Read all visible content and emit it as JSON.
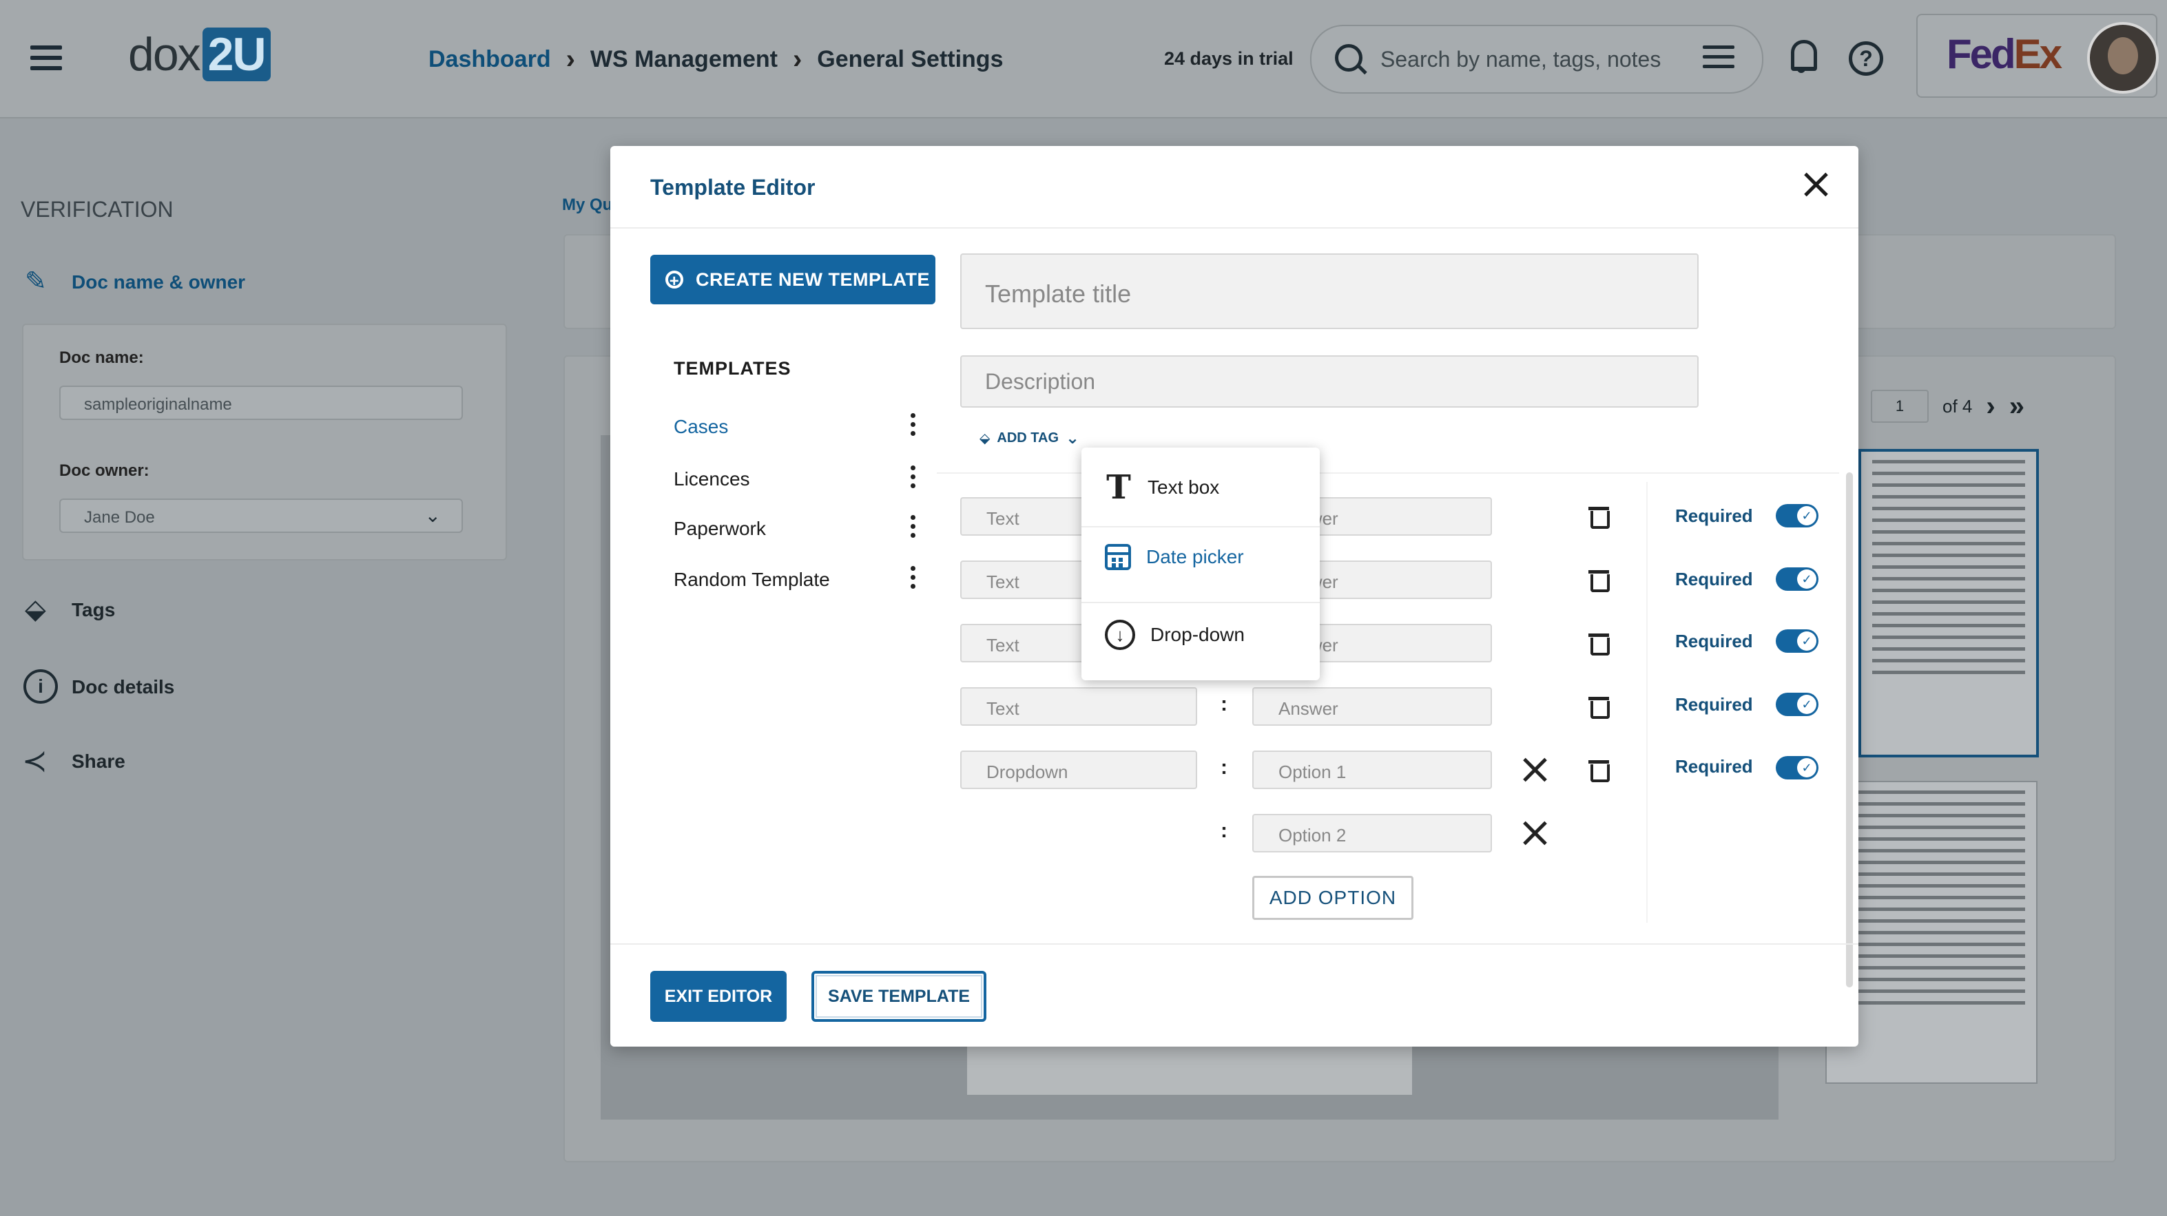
{
  "header": {
    "logo_text": "dox",
    "logo_suffix": "2U",
    "breadcrumb": [
      "Dashboard",
      "WS Management",
      "General Settings"
    ],
    "trial_text": "24 days in trial",
    "search_placeholder": "Search by name, tags, notes",
    "brand_fe": "Fed",
    "brand_ex": "Ex"
  },
  "sidebar": {
    "section_title": "VERIFICATION",
    "items": [
      {
        "label": "Doc name & owner",
        "icon": "pencil-icon"
      },
      {
        "label": "Tags",
        "icon": "tag-icon"
      },
      {
        "label": "Doc details",
        "icon": "info-icon"
      },
      {
        "label": "Share",
        "icon": "share-icon"
      }
    ],
    "doc_name_label": "Doc name:",
    "doc_name_value": "sampleoriginalname",
    "doc_owner_label": "Doc owner:",
    "doc_owner_value": "Jane Doe"
  },
  "background": {
    "my_queue_label": "My Qu",
    "page_current": "1",
    "page_total": "of 4"
  },
  "modal": {
    "title": "Template Editor",
    "create_button": "CREATE NEW TEMPLATE",
    "templates_heading": "TEMPLATES",
    "templates": [
      "Cases",
      "Licences",
      "Paperwork",
      "Random Template"
    ],
    "title_placeholder": "Template title",
    "description_placeholder": "Description",
    "add_tag_label": "ADD TAG",
    "rows": [
      {
        "type": "Text",
        "value": "Answer",
        "required": "Required"
      },
      {
        "type": "Text",
        "value": "Answer",
        "required": "Required"
      },
      {
        "type": "Text",
        "value": "Answer",
        "required": "Required"
      },
      {
        "type": "Text",
        "value": "Answer",
        "required": "Required"
      },
      {
        "type": "Dropdown",
        "value": "Option 1",
        "required": "Required"
      },
      {
        "type": "",
        "value": "Option 2",
        "required": ""
      }
    ],
    "add_option_label": "ADD OPTION",
    "exit_button": "EXIT EDITOR",
    "save_button": "SAVE TEMPLATE",
    "field_type_menu": [
      {
        "label": "Text box",
        "icon": "text-t-icon"
      },
      {
        "label": "Date picker",
        "icon": "calendar-icon"
      },
      {
        "label": "Drop-down",
        "icon": "dropdown-circle-icon"
      }
    ]
  },
  "colors": {
    "accent": "#1465a0",
    "overlay_bg": "#9aa0a4"
  }
}
